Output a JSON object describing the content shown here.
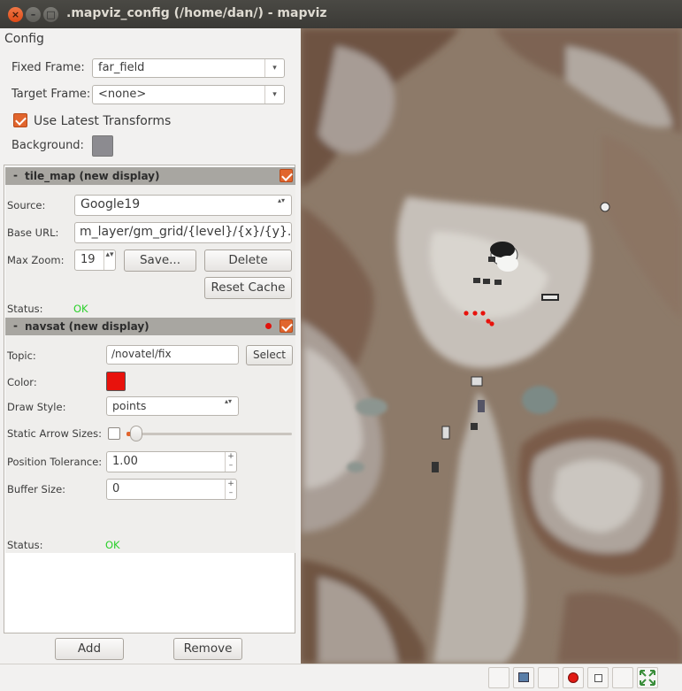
{
  "window": {
    "title": ".mapviz_config (/home/dan/) - mapviz",
    "close": "×",
    "minimize": "–",
    "maximize": "□"
  },
  "config": {
    "title": "Config",
    "fixed_frame_label": "Fixed Frame:",
    "fixed_frame_value": "far_field",
    "target_frame_label": "Target Frame:",
    "target_frame_value": "<none>",
    "use_latest_transforms": "Use Latest Transforms",
    "background_label": "Background:",
    "background_color": "#8c8b90"
  },
  "tile_map": {
    "title": "tile_map (new display)",
    "source_label": "Source:",
    "source_value": "Google19",
    "base_url_label": "Base URL:",
    "base_url_value": "m_layer/gm_grid/{level}/{x}/{y}.png",
    "max_zoom_label": "Max Zoom:",
    "max_zoom_value": "19",
    "save_label": "Save...",
    "delete_label": "Delete",
    "reset_cache_label": "Reset Cache",
    "status_label": "Status:",
    "status_value": "OK"
  },
  "navsat": {
    "title": "navsat (new display)",
    "topic_label": "Topic:",
    "topic_value": "/novatel/fix",
    "select_label": "Select",
    "color_label": "Color:",
    "color_value": "#e8120c",
    "draw_style_label": "Draw Style:",
    "draw_style_value": "points",
    "static_arrow_label": "Static Arrow Sizes:",
    "position_tolerance_label": "Position Tolerance:",
    "position_tolerance_value": "1.00",
    "buffer_size_label": "Buffer Size:",
    "buffer_size_value": "0",
    "status_label": "Status:",
    "status_value": "OK"
  },
  "footer": {
    "add_label": "Add",
    "remove_label": "Remove"
  },
  "common": {
    "collapse": "-",
    "arrow_updown": "▴▾",
    "arrow_down": "▾",
    "spin_up": "+",
    "spin_down": "–"
  },
  "colors": {
    "accent_orange": "#e1652d",
    "status_ok": "#2ad02a",
    "record_red": "#e11a14"
  },
  "icons": [
    "close-icon",
    "minimize-icon",
    "maximize-icon",
    "checkbox-icon",
    "screenshot-icon",
    "record-icon",
    "stop-icon",
    "fit-icon"
  ]
}
